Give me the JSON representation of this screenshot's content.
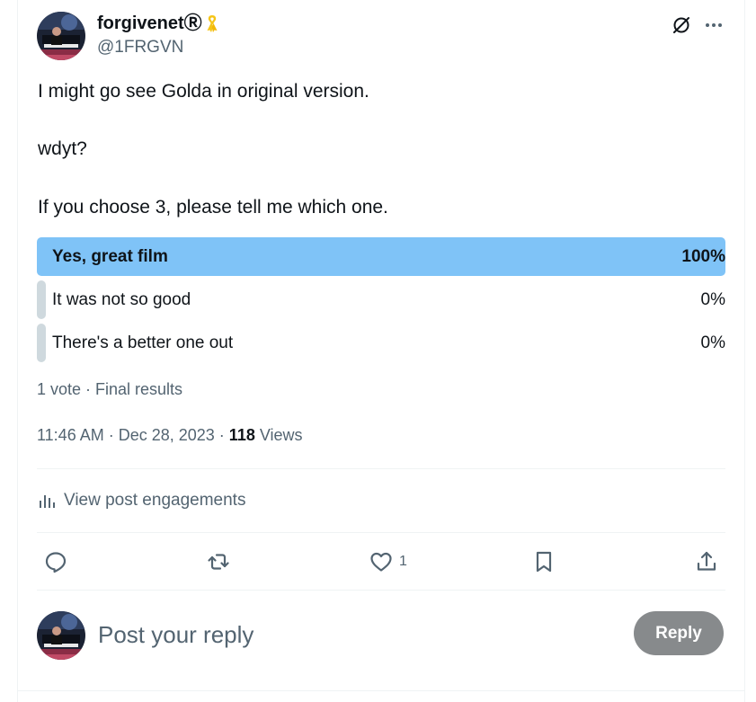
{
  "author": {
    "display_name": "forgivenetⓇ",
    "handle": "@1FRGVN",
    "ribbon_icon": "yellow-ribbon-icon",
    "ribbon_color": "#f5c518"
  },
  "header_icons": [
    "grok-icon",
    "more-icon"
  ],
  "tweet": {
    "lines": [
      "I might go see Golda in original version.",
      "wdyt?",
      "If you choose 3, please tell me which one."
    ]
  },
  "poll": {
    "options": [
      {
        "label": "Yes, great film",
        "percent_text": "100%",
        "percent": 100,
        "winner": true
      },
      {
        "label": "It was not so good",
        "percent_text": "0%",
        "percent": 0,
        "winner": false
      },
      {
        "label": "There's a better one out",
        "percent_text": "0%",
        "percent": 0,
        "winner": false
      }
    ],
    "summary": "1 vote · Final results",
    "winner_color": "#7fc3f7",
    "other_color": "#cfd9de"
  },
  "meta": {
    "time": "11:46 AM",
    "date": "Dec 28, 2023",
    "separator": " · ",
    "views_count": "118",
    "views_label": "Views"
  },
  "engagements": {
    "label": "View post engagements",
    "icon": "analytics-icon"
  },
  "actions": {
    "reply": {
      "icon": "reply-icon"
    },
    "repost": {
      "icon": "repost-icon"
    },
    "like": {
      "icon": "heart-icon",
      "count": "1"
    },
    "bookmark": {
      "icon": "bookmark-icon"
    },
    "share": {
      "icon": "share-icon"
    }
  },
  "composer": {
    "placeholder": "Post your reply",
    "button_label": "Reply",
    "button_color": "#878a8c"
  }
}
